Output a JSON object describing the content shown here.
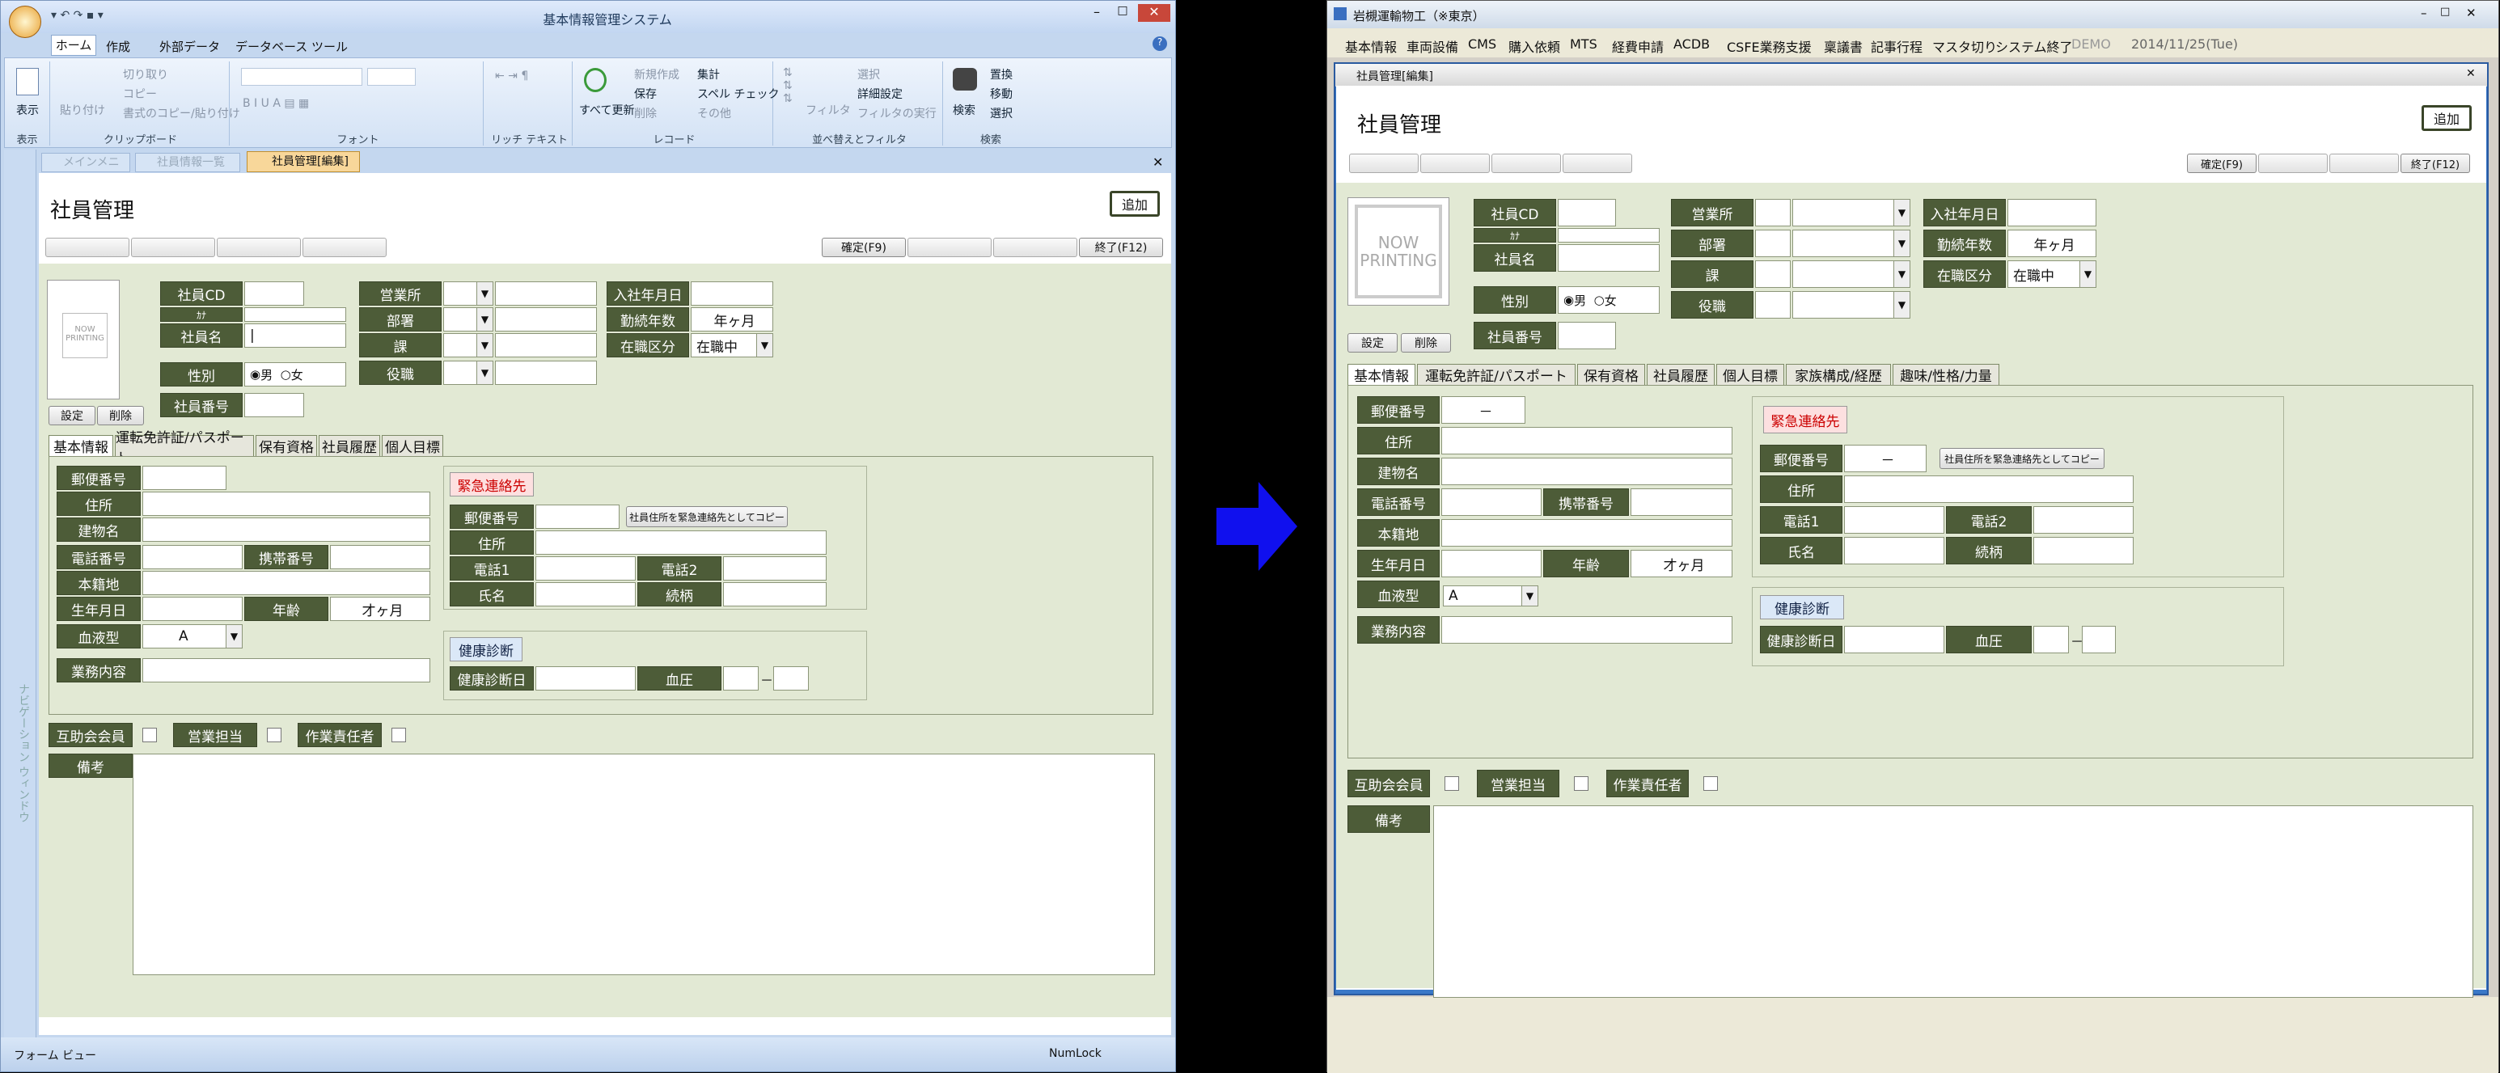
{
  "left": {
    "title": "基本情報管理システム",
    "ribbon_tabs": [
      "ホーム",
      "作成",
      "外部データ",
      "データベース ツール"
    ],
    "ribbon_groups": [
      {
        "caption": "表示",
        "items": [
          "表示"
        ]
      },
      {
        "caption": "クリップボード",
        "items": [
          "貼り付け",
          "切り取り",
          "コピー",
          "書式のコピー/貼り付け"
        ]
      },
      {
        "caption": "フォント",
        "items": []
      },
      {
        "caption": "リッチ テキスト",
        "items": []
      },
      {
        "caption": "レコード",
        "items": [
          "すべて更新",
          "新規作成",
          "保存",
          "削除",
          "集計",
          "スペル チェック",
          "その他"
        ]
      },
      {
        "caption": "並べ替えとフィルタ",
        "items": [
          "フィルタ",
          "選択",
          "詳細設定",
          "フィルタの実行"
        ]
      },
      {
        "caption": "検索",
        "items": [
          "検索",
          "置換",
          "移動",
          "選択"
        ]
      }
    ],
    "doc_tabs": [
      "メインメニュー",
      "社員情報一覧",
      "社員管理[編集]"
    ],
    "nav_pane_label": "ナビゲーション ウィンドウ",
    "status_left": "フォーム ビュー",
    "status_right": "NumLock"
  },
  "right": {
    "title": "岩槻運輸物工（※東京）",
    "menu": [
      "基本情報",
      "車両設備",
      "CMS",
      "購入依頼",
      "MTS",
      "経費申請",
      "ACDB",
      "CSFE業務支援",
      "稟議書",
      "記事行程",
      "マスタ切り",
      "システム終了"
    ],
    "demo": "DEMO",
    "date": "2014/11/25(Tue)",
    "subwindow_title": "社員管理[編集]"
  },
  "form": {
    "title": "社員管理",
    "add_button": "追加",
    "confirm_button": "確定(F9)",
    "end_button": "終了(F12)",
    "photo_text": "NOW PRINTING",
    "set_button": "設定",
    "delete_button": "削除",
    "labels": {
      "emp_cd": "社員CD",
      "kana": "ｶﾅ",
      "emp_name": "社員名",
      "gender": "性別",
      "emp_no": "社員番号",
      "office": "営業所",
      "dept": "部署",
      "section": "課",
      "position": "役職",
      "join_date": "入社年月日",
      "years": "勤続年数",
      "status": "在職区分"
    },
    "gender_male": "男",
    "gender_female": "女",
    "years_value": "年ヶ月",
    "status_value": "在職中",
    "tabs_left": [
      "基本情報",
      "運転免許証/パスポート",
      "保有資格",
      "社員履歴",
      "個人目標"
    ],
    "tabs_right": [
      "基本情報",
      "運転免許証/パスポート",
      "保有資格",
      "社員履歴",
      "個人目標",
      "家族構成/経歴",
      "趣味/性格/力量"
    ],
    "basic": {
      "postal": "郵便番号",
      "address": "住所",
      "building": "建物名",
      "phone": "電話番号",
      "mobile": "携帯番号",
      "domicile": "本籍地",
      "birth": "生年月日",
      "age": "年齢",
      "age_value": "才ヶ月",
      "blood": "血液型",
      "blood_value": "A",
      "duties": "業務内容",
      "postal_dash": "－"
    },
    "emergency": {
      "heading": "緊急連絡先",
      "postal": "郵便番号",
      "copy_button": "社員住所を緊急連絡先としてコピー",
      "address": "住所",
      "tel1": "電話1",
      "tel2": "電話2",
      "name": "氏名",
      "relation": "続柄",
      "postal_dash": "－"
    },
    "health": {
      "heading": "健康診断",
      "date": "健康診断日",
      "bp": "血圧",
      "bp_dash": "－"
    },
    "flags": {
      "mutual": "互助会会員",
      "sales": "営業担当",
      "work": "作業責任者"
    },
    "remarks": "備考"
  },
  "colors": {
    "arrow": "#1010ee",
    "label_bg": "#4d5c38",
    "panel_bg": "#e2e9d4",
    "ribbon_bg": "#d6e5f6"
  }
}
